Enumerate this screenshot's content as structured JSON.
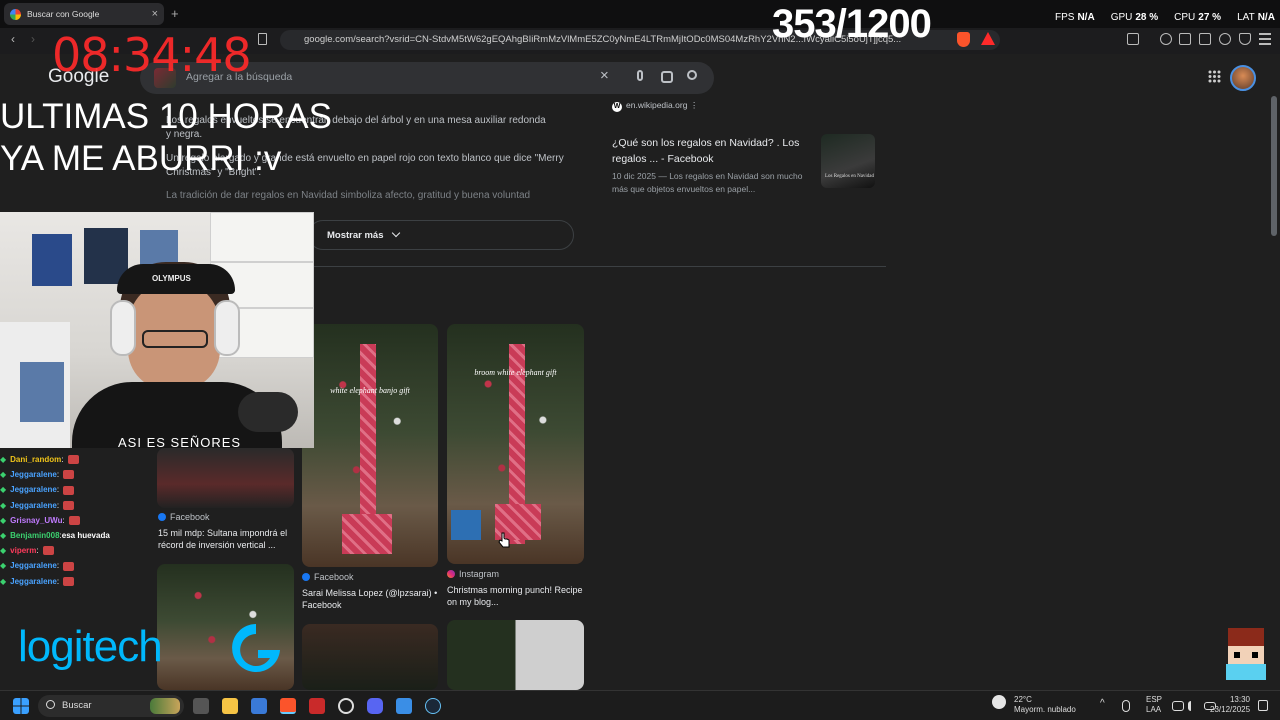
{
  "browser": {
    "tab_title": "Buscar con Google",
    "tab_close": "×",
    "new_tab": "+",
    "url": "google.com/search?vsrid=CN-StdvM5tW62gEQAhgBIiRmMzVlMmE5ZC0yNmE4LTRmMjItODc0MS04MzRhY2VhN2...fWcyaliC5i5oUjTjjcq5...",
    "back": "‹",
    "forward": "›"
  },
  "overlay": {
    "clock": "08:34:48",
    "counter": "353/1200",
    "fps_label": "FPS",
    "fps_value": "N/A",
    "gpu_label": "GPU",
    "gpu_value": "28 %",
    "cpu_label": "CPU",
    "cpu_value": "27 %",
    "lat_label": "LAT",
    "lat_value": "N/A",
    "big_line1": "ULTIMAS 10 HORAS",
    "big_line2": "YA ME ABURRI :v"
  },
  "google": {
    "logo": "Google",
    "search_placeholder": "Agregar a la búsqueda",
    "clear_icon": "×",
    "apps_icon": "⋮⋮⋮"
  },
  "ai_overview": {
    "bullet1": "Los regalos envueltos se encuentran debajo del árbol y en una mesa auxiliar redonda y negra.",
    "bullet2": "Un regalo alargado y grande está envuelto en papel rojo con texto blanco que dice \"Merry Christmas\" y \"Bright\".",
    "bullet3": "La tradición de dar regalos en Navidad simboliza afecto, gratitud y buena voluntad",
    "show_more": "Mostrar más"
  },
  "source_card": {
    "domain": "en.wikipedia.org",
    "title": "¿Qué son los regalos en Navidad? . Los regalos ... - Facebook",
    "date": "10 dic 2025",
    "desc": "— Los regalos en Navidad son mucho más que objetos envueltos en papel...",
    "thumb_text": "Los Regalos en Navidad"
  },
  "images": [
    {
      "source": "Facebook",
      "title": "15 mil mdp: Sultana impondrá el récord de inversión vertical ..."
    },
    {
      "source": "Facebook",
      "title": "Sarai Melissa Lopez (@lpzsarai) • Facebook",
      "overlay": "white elephant banjo gift"
    },
    {
      "source": "Instagram",
      "title": "Christmas morning punch! Recipe on my blog...",
      "overlay": "broom white elephant gift"
    }
  ],
  "webcam": {
    "cap_text": "OLYMPUS",
    "shirt_text": "ASI ES SEÑORES"
  },
  "chat": [
    {
      "name": "Dani_random",
      "msg": "",
      "color": "#f0c419"
    },
    {
      "name": "Jeggaralene",
      "msg": "",
      "color": "#4aa3ff"
    },
    {
      "name": "Jeggaralene",
      "msg": "",
      "color": "#4aa3ff"
    },
    {
      "name": "Jeggaralene",
      "msg": "",
      "color": "#4aa3ff"
    },
    {
      "name": "Grisnay_UWu",
      "msg": "",
      "color": "#c07bff"
    },
    {
      "name": "Benjamin008",
      "msg": "esa huevada",
      "color": "#3bd16f"
    },
    {
      "name": "viperm",
      "msg": "",
      "color": "#ff3b5c"
    },
    {
      "name": "Jeggaralene",
      "msg": "",
      "color": "#4aa3ff"
    },
    {
      "name": "Jeggaralene",
      "msg": "",
      "color": "#4aa3ff"
    }
  ],
  "brand": {
    "logitech": "logitech"
  },
  "taskbar": {
    "search": "Buscar",
    "temp": "22°C",
    "weather": "Mayorm. nublado",
    "lang1": "ESP",
    "lang2": "LAA",
    "time": "13:30",
    "date": "23/12/2025"
  }
}
